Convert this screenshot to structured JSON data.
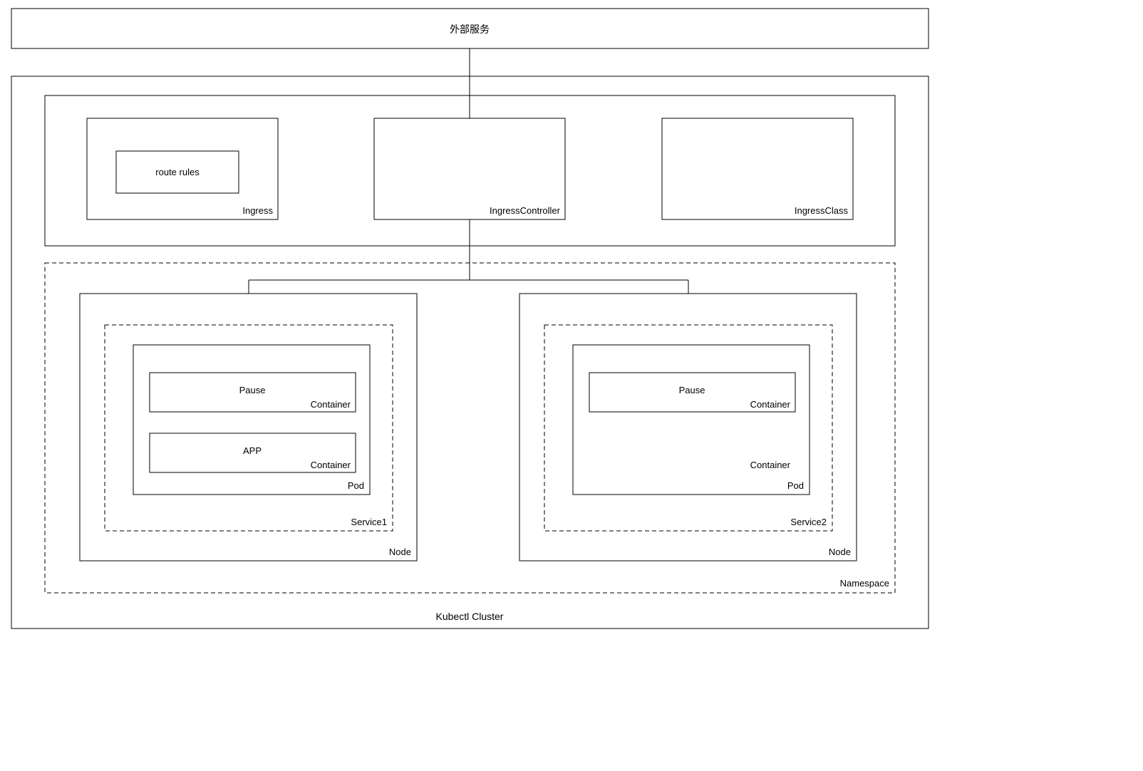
{
  "external_service": "外部服务",
  "cluster_label": "Kubectl Cluster",
  "ingress_row": {
    "ingress": {
      "label": "Ingress",
      "route_rules": "route rules"
    },
    "controller": "IngressController",
    "class": "IngressClass"
  },
  "namespace_label": "Namespace",
  "left": {
    "node": "Node",
    "service": "Service1",
    "pod": "Pod",
    "container_label": "Container",
    "pause": "Pause",
    "app": "APP"
  },
  "right": {
    "node": "Node",
    "service": "Service2",
    "pod": "Pod",
    "container_label": "Container",
    "pause": "Pause"
  }
}
